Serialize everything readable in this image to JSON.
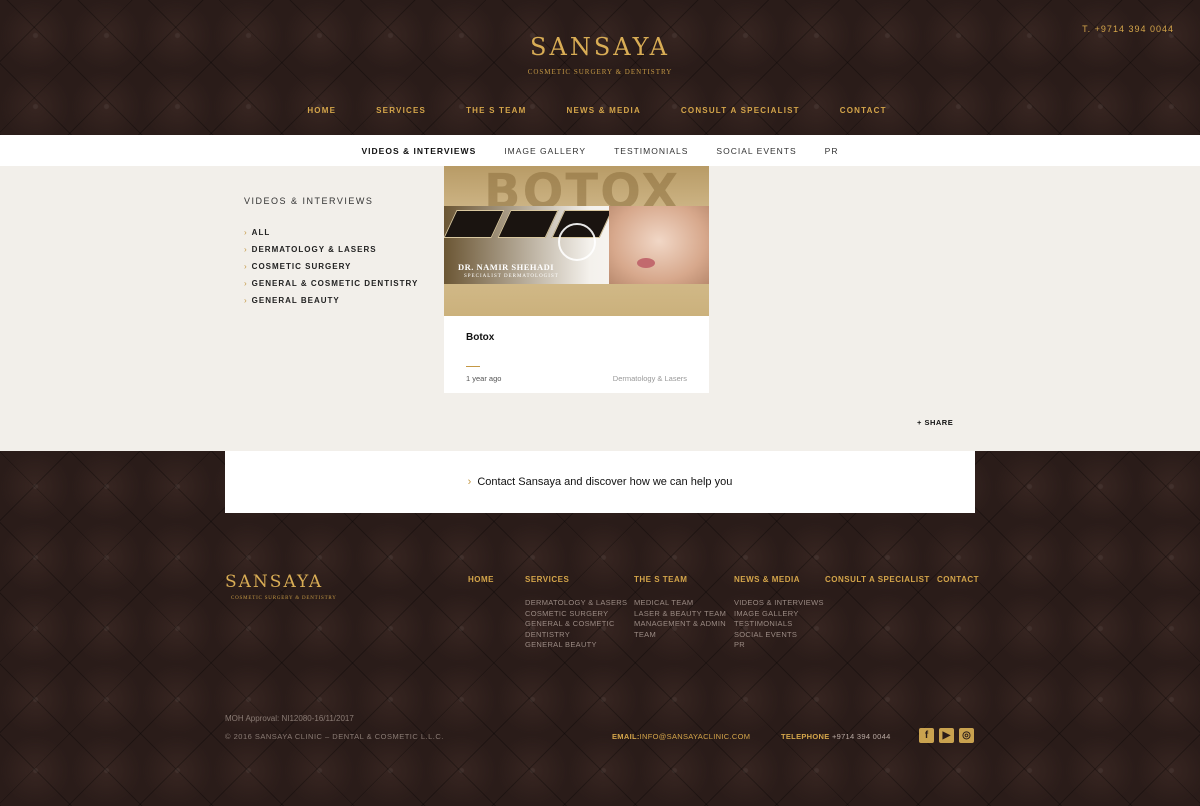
{
  "header": {
    "phone": "T. +9714 394 0044",
    "logo_text": "SANSAYA",
    "logo_subtitle": "COSMETIC SURGERY & DENTISTRY",
    "nav": [
      "HOME",
      "SERVICES",
      "THE S TEAM",
      "NEWS & MEDIA",
      "CONSULT A SPECIALIST",
      "CONTACT"
    ]
  },
  "subnav": {
    "items": [
      "VIDEOS & INTERVIEWS",
      "IMAGE GALLERY",
      "TESTIMONIALS",
      "SOCIAL EVENTS",
      "PR"
    ],
    "active_index": 0
  },
  "sidebar": {
    "title": "VIDEOS & INTERVIEWS",
    "items": [
      "ALL",
      "DERMATOLOGY & LASERS",
      "COSMETIC SURGERY",
      "GENERAL & COSMETIC DENTISTRY",
      "GENERAL BEAUTY"
    ]
  },
  "card": {
    "thumbnail_word": "BOTOX",
    "thumbnail_doctor": "DR. NAMIR SHEHADI",
    "thumbnail_doctor_title": "SPECIALIST DERMATOLOGIST",
    "title": "Botox",
    "date": "1 year ago",
    "category": "Dermatology & Lasers"
  },
  "share_label": "+ SHARE",
  "footer": {
    "cta": "Contact Sansaya and discover how we can help you",
    "logo_text": "SANSAYA",
    "logo_subtitle": "COSMETIC SURGERY & DENTISTRY",
    "columns": {
      "home": {
        "head": "HOME",
        "links": []
      },
      "services": {
        "head": "SERVICES",
        "links": [
          "DERMATOLOGY & LASERS",
          "COSMETIC SURGERY",
          "GENERAL & COSMETIC",
          "DENTISTRY",
          "GENERAL BEAUTY"
        ]
      },
      "team": {
        "head": "THE S TEAM",
        "links": [
          "MEDICAL TEAM",
          "LASER & BEAUTY TEAM",
          "MANAGEMENT & ADMIN",
          "TEAM"
        ]
      },
      "news": {
        "head": "NEWS & MEDIA",
        "links": [
          "VIDEOS & INTERVIEWS",
          "IMAGE GALLERY",
          "TESTIMONIALS",
          "SOCIAL EVENTS",
          "PR"
        ]
      },
      "consult": {
        "head": "CONSULT A SPECIALIST",
        "links": []
      },
      "contact": {
        "head": "CONTACT",
        "links": []
      }
    },
    "moh": "MOH Approval: NI12080-16/11/2017",
    "copyright": "© 2016   SANSAYA CLINIC – DENTAL & COSMETIC L.L.C.",
    "email_label": "EMAIL:",
    "email_value": "INFO@SANSAYACLINIC.COM",
    "telephone_label": "TELEPHONE",
    "telephone_value": "+9714 394 0044",
    "social_icons": [
      "facebook-icon",
      "youtube-icon",
      "instagram-icon"
    ]
  },
  "colors": {
    "gold": "#d4a54a",
    "dark_brown": "#2a1c19",
    "content_bg": "#f2efea"
  }
}
